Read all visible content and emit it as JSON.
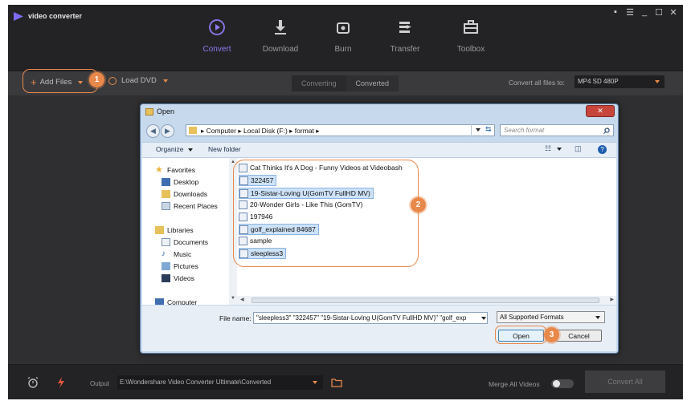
{
  "app": {
    "title": "video converter",
    "window_controls": [
      "▪",
      "☰",
      "_",
      "☐",
      "✕"
    ]
  },
  "nav": {
    "tabs": [
      {
        "label": "Convert",
        "icon": "convert-icon",
        "active": true
      },
      {
        "label": "Download",
        "icon": "download-icon",
        "active": false
      },
      {
        "label": "Burn",
        "icon": "burn-icon",
        "active": false
      },
      {
        "label": "Transfer",
        "icon": "transfer-icon",
        "active": false
      },
      {
        "label": "Toolbox",
        "icon": "toolbox-icon",
        "active": false
      }
    ]
  },
  "toolbar": {
    "add_files": "Add Files",
    "load_dvd": "Load DVD",
    "converting": "Converting",
    "converted": "Converted",
    "convert_all_to": "Convert all files to:",
    "format": "MP4 SD 480P"
  },
  "bottom": {
    "output_label": "Output",
    "output_path": "E:\\Wondershare Video Converter Ultimate\\Converted",
    "merge_label": "Merge All Videos",
    "merge_on": false,
    "convert_all": "Convert All"
  },
  "callouts": [
    "1",
    "2",
    "3"
  ],
  "dialog": {
    "title": "Open",
    "close": "✕",
    "breadcrumb": [
      "Computer",
      "Local Disk (F:)",
      "format"
    ],
    "search_placeholder": "Search format",
    "organize": "Organize",
    "new_folder": "New folder",
    "nav_items": {
      "favorites": "Favorites",
      "desktop": "Desktop",
      "downloads": "Downloads",
      "recent": "Recent Places",
      "libraries": "Libraries",
      "documents": "Documents",
      "music": "Music",
      "pictures": "Pictures",
      "videos": "Videos",
      "computer": "Computer"
    },
    "files": [
      {
        "name": "Cat Thinks It's A Dog - Funny Videos at Videobash",
        "selected": false
      },
      {
        "name": "322457",
        "selected": true
      },
      {
        "name": "19-Sistar-Loving U(GomTV FullHD MV)",
        "selected": true
      },
      {
        "name": "20-Wonder Girls - Like This (GomTV)",
        "selected": false
      },
      {
        "name": "197946",
        "selected": false
      },
      {
        "name": "golf_explained 84687",
        "selected": true
      },
      {
        "name": "sample",
        "selected": false
      },
      {
        "name": "sleepless3",
        "selected": true
      }
    ],
    "file_name_label": "File name:",
    "file_name_value": "\"sleepless3\" \"322457\" \"19-Sistar-Loving U(GomTV FullHD MV)\" \"golf_exp",
    "file_type": "All Supported Formats",
    "open": "Open",
    "cancel": "Cancel"
  },
  "colors": {
    "accent_purple": "#8c7cf3",
    "accent_orange": "#e8884a",
    "app_bg": "#2f2f31"
  }
}
